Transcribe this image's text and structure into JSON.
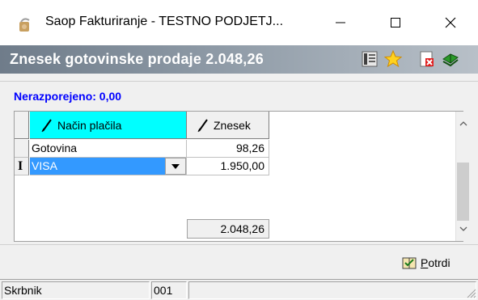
{
  "window": {
    "title": "Saop Fakturiranje - TESTNO PODJETJ...",
    "minimize_label": "—",
    "maximize_label": "☐",
    "close_label": "✕"
  },
  "header": {
    "title": "Znesek gotovinske prodaje 2.048,26",
    "icons": [
      "list-icon",
      "star-icon",
      "delete-document-icon",
      "books-icon"
    ]
  },
  "unallocated": "Nerazporejeno: 0,00",
  "grid": {
    "columns": [
      "Način plačila",
      "Znesek"
    ],
    "rows": [
      {
        "method": "Gotovina",
        "amount": "98,26"
      },
      {
        "method": "VISA",
        "amount": "1.950,00"
      }
    ],
    "total": "2.048,26"
  },
  "actions": {
    "confirm_prefix": "P",
    "confirm_rest": "otrdi"
  },
  "status": {
    "user": "Skrbnik",
    "code": "001",
    "extra": ""
  },
  "colors": {
    "header_highlight": "#00ffff",
    "selection": "#3399ff",
    "unallocated_text": "#0000ff"
  }
}
